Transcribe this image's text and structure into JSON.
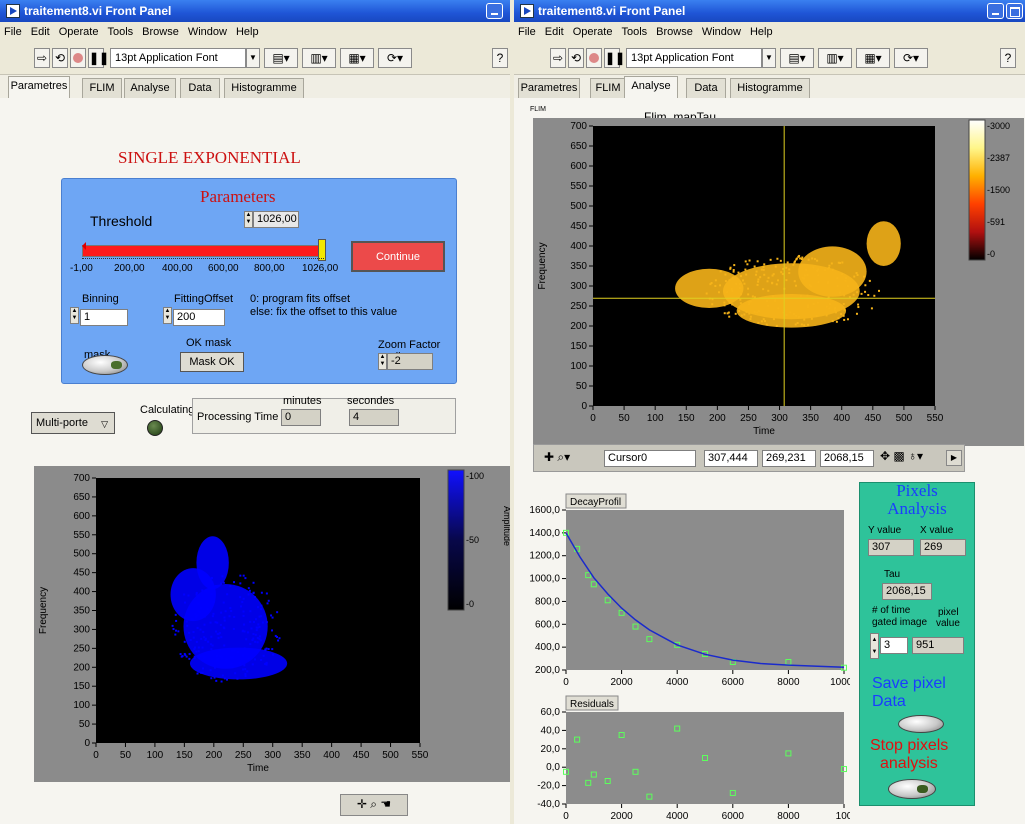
{
  "left": {
    "title": "traitement8.vi Front Panel",
    "menu": [
      "File",
      "Edit",
      "Operate",
      "Tools",
      "Browse",
      "Window",
      "Help"
    ],
    "font_select": "13pt Application Font",
    "tabs": [
      "Parametres",
      "FLIM",
      "Analyse",
      "Data",
      "Histogramme"
    ],
    "active_tab": "Parametres",
    "heading": "SINGLE EXPONENTIAL",
    "params": {
      "title": "Parameters",
      "threshold_label": "Threshold",
      "threshold_value": "1026,00",
      "slider_ticks": [
        "-1,00",
        "200,00",
        "400,00",
        "600,00",
        "800,00",
        "1026,00"
      ],
      "slider_fraction": 1.0,
      "continue_label": "Continue",
      "binning_label": "Binning",
      "binning_value": "1",
      "fitting_offset_label": "FittingOffset",
      "fitting_offset_value": "200",
      "offset_note_1": "0: program fits offset",
      "offset_note_2": "else: fix the offset to this value",
      "mask_label": "mask",
      "ok_mask_label": "OK mask",
      "mask_ok_button": "Mask OK",
      "zoom_label": "Zoom Factor seuil",
      "zoom_value": "-2"
    },
    "multi_porte": "Multi-porte",
    "calculating_label": "Calculating",
    "processing_time_label": "Processing Time",
    "minutes_label": "minutes",
    "minutes_value": "0",
    "secondes_label": "secondes",
    "secondes_value": "4",
    "plot": {
      "xlabel": "Time",
      "ylabel": "Frequency",
      "xticks": [
        "0",
        "50",
        "100",
        "150",
        "200",
        "250",
        "300",
        "350",
        "400",
        "450",
        "500",
        "550"
      ],
      "yticks": [
        "700",
        "650",
        "600",
        "550",
        "500",
        "450",
        "400",
        "350",
        "300",
        "250",
        "200",
        "150",
        "100",
        "50",
        "0"
      ],
      "scale_label": "Amplitude",
      "scale_ticks": [
        "-100",
        "-50",
        "-0"
      ],
      "color": "#0000ff"
    }
  },
  "right": {
    "title": "traitement8.vi Front Panel",
    "menu": [
      "File",
      "Edit",
      "Operate",
      "Tools",
      "Browse",
      "Window",
      "Help"
    ],
    "font_select": "13pt Application Font",
    "tabs": [
      "Parametres",
      "FLIM",
      "Analyse",
      "Data",
      "Histogramme"
    ],
    "active_tab": "Analyse",
    "flim_small_label": "FLIM",
    "plot_title": "Flim_mapTau",
    "plot": {
      "xlabel": "Time",
      "ylabel": "Frequency",
      "xticks": [
        "0",
        "50",
        "100",
        "150",
        "200",
        "250",
        "300",
        "350",
        "400",
        "450",
        "500",
        "550"
      ],
      "yticks": [
        "700",
        "650",
        "600",
        "550",
        "500",
        "450",
        "400",
        "350",
        "300",
        "250",
        "200",
        "150",
        "100",
        "50",
        "0"
      ],
      "scale_ticks": [
        "-3000",
        "-2387",
        "-1500",
        "-591",
        "-0"
      ],
      "cursor_x": 307.444,
      "cursor_y": 269.231
    },
    "cursor": {
      "name": "Cursor0",
      "x": "307,444",
      "y": "269,231",
      "z": "2068,15"
    },
    "pixels_analysis": {
      "title_1": "Pixels",
      "title_2": "Analysis",
      "y_label": "Y value",
      "x_label": "X value",
      "y_value": "307",
      "x_value": "269",
      "tau_label": "Tau",
      "tau_value": "2068,15",
      "gates_label_1": "# of time",
      "gates_label_2": "gated image",
      "gates_value": "3",
      "pixel_label_1": "pixel",
      "pixel_label_2": "value",
      "pixel_value": "951",
      "save_1": "Save pixel",
      "save_2": "Data",
      "stop_1": "Stop pixels",
      "stop_2": "analysis"
    }
  },
  "colors": {
    "params_bg": "#6ea6f4",
    "analysis_bg": "#2ec39a",
    "title_red": "#cc1111",
    "blue_text": "#1a3cff"
  },
  "chart_data": [
    {
      "type": "line",
      "title": "DecayProfil",
      "xlabel": "",
      "ylabel": "",
      "xlim": [
        0,
        10000
      ],
      "ylim": [
        200,
        1600
      ],
      "xticks": [
        "0",
        "2000",
        "4000",
        "6000",
        "8000",
        "10000"
      ],
      "yticks": [
        "1600,0",
        "1400,0",
        "1200,0",
        "1000,0",
        "800,0",
        "600,0",
        "400,0",
        "200,0"
      ],
      "series": [
        {
          "marker": "square",
          "x": [
            0,
            400,
            800,
            1000,
            1500,
            2000,
            2500,
            3000,
            4000,
            5000,
            6000,
            8000,
            10000
          ],
          "y": [
            1400,
            1260,
            1030,
            950,
            810,
            700,
            580,
            470,
            420,
            340,
            270,
            270,
            220
          ]
        },
        {
          "line": true,
          "x": [
            0,
            500,
            1000,
            1500,
            2000,
            2500,
            3000,
            4000,
            5000,
            6000,
            7000,
            8000,
            10000
          ],
          "y": [
            1400,
            1190,
            1008,
            866,
            742,
            638,
            551,
            420,
            337,
            287,
            257,
            243,
            224
          ]
        }
      ],
      "grid": false
    },
    {
      "type": "scatter",
      "title": "Residuals",
      "xlabel": "",
      "ylabel": "",
      "xlim": [
        0,
        10000
      ],
      "ylim": [
        -40,
        60
      ],
      "xticks": [
        "0",
        "2000",
        "4000",
        "6000",
        "8000",
        "100"
      ],
      "yticks": [
        "60,0",
        "40,0",
        "20,0",
        "0,0",
        "-20,0",
        "-40,0"
      ],
      "series": [
        {
          "x": [
            0,
            400,
            800,
            1000,
            1500,
            2000,
            2500,
            3000,
            4000,
            5000,
            6000,
            8000,
            10000
          ],
          "y": [
            -5,
            30,
            -17,
            -8,
            -15,
            35,
            -5,
            -32,
            42,
            10,
            -28,
            15,
            -2
          ]
        }
      ],
      "grid": false
    }
  ]
}
